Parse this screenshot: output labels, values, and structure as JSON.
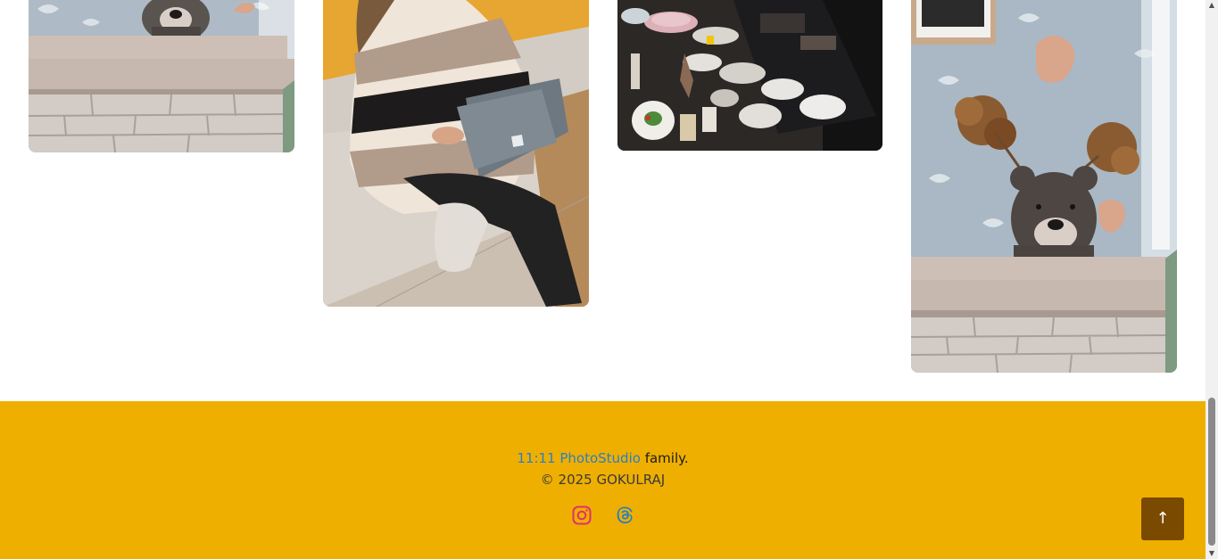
{
  "gallery": {
    "photos": [
      {
        "alt": "bear vase on mantel"
      },
      {
        "alt": "woman with laptop"
      },
      {
        "alt": "table of dishes"
      },
      {
        "alt": "bear vase with dried flowers"
      }
    ]
  },
  "footer": {
    "brand_name": "11:11 PhotoStudio",
    "brand_suffix": " family.",
    "copyright": "© 2025 GOKULRAJ",
    "socials": [
      {
        "icon": "instagram-icon",
        "color": "#e1306c"
      },
      {
        "icon": "threads-icon",
        "color": "#2a7fc4"
      }
    ],
    "background_color": "#efaf00",
    "brand_color": "#2a7fc4"
  },
  "back_to_top": {
    "label": "↑",
    "color": "#7a4a00"
  },
  "scrollbar": {
    "up_arrow": "▲",
    "down_arrow": "▼"
  }
}
